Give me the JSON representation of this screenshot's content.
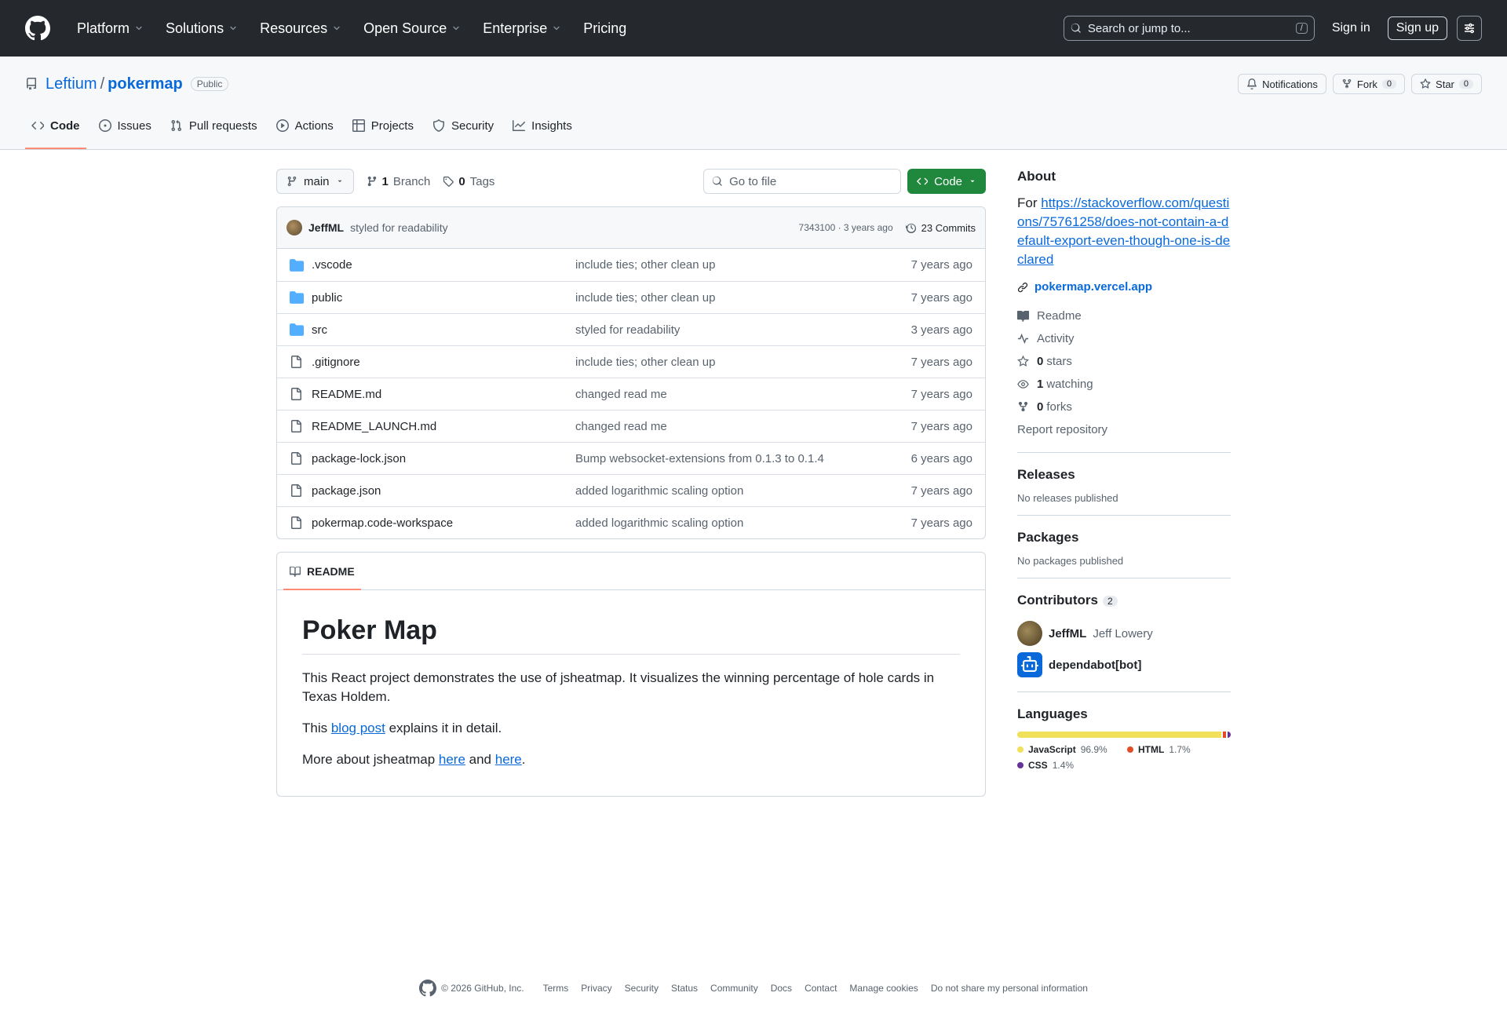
{
  "header": {
    "nav": [
      {
        "label": "Platform",
        "dropdown": true
      },
      {
        "label": "Solutions",
        "dropdown": true
      },
      {
        "label": "Resources",
        "dropdown": true
      },
      {
        "label": "Open Source",
        "dropdown": true
      },
      {
        "label": "Enterprise",
        "dropdown": true
      },
      {
        "label": "Pricing",
        "dropdown": false
      }
    ],
    "search_placeholder": "Search or jump to...",
    "search_shortcut": "/",
    "sign_in": "Sign in",
    "sign_up": "Sign up"
  },
  "repo": {
    "owner": "Leftium",
    "separator": "/",
    "name": "pokermap",
    "visibility": "Public",
    "notifications_label": "Notifications",
    "fork_label": "Fork",
    "fork_count": "0",
    "star_label": "Star",
    "star_count": "0"
  },
  "tabs": [
    {
      "label": "Code",
      "icon": "code-icon",
      "active": true
    },
    {
      "label": "Issues",
      "icon": "issue-icon",
      "active": false
    },
    {
      "label": "Pull requests",
      "icon": "pull-request-icon",
      "active": false
    },
    {
      "label": "Actions",
      "icon": "play-icon",
      "active": false
    },
    {
      "label": "Projects",
      "icon": "table-icon",
      "active": false
    },
    {
      "label": "Security",
      "icon": "shield-icon",
      "active": false
    },
    {
      "label": "Insights",
      "icon": "graph-icon",
      "active": false
    }
  ],
  "filebar": {
    "branch": "main",
    "branch_count": "1",
    "branch_label": "Branch",
    "tag_count": "0",
    "tag_label": "Tags",
    "goto_placeholder": "Go to file",
    "code_button": "Code"
  },
  "commit": {
    "author": "JeffML",
    "message": "styled for readability",
    "meta": "7343100 · 3 years ago",
    "commits": "23 Commits"
  },
  "files": [
    {
      "name": ".vscode",
      "type": "dir",
      "message": "include ties; other clean up",
      "age": "7 years ago"
    },
    {
      "name": "public",
      "type": "dir",
      "message": "include ties; other clean up",
      "age": "7 years ago"
    },
    {
      "name": "src",
      "type": "dir",
      "message": "styled for readability",
      "age": "3 years ago"
    },
    {
      "name": ".gitignore",
      "type": "file",
      "message": "include ties; other clean up",
      "age": "7 years ago"
    },
    {
      "name": "README.md",
      "type": "file",
      "message": "changed read me",
      "age": "7 years ago"
    },
    {
      "name": "README_LAUNCH.md",
      "type": "file",
      "message": "changed read me",
      "age": "7 years ago"
    },
    {
      "name": "package-lock.json",
      "type": "file",
      "message": "Bump websocket-extensions from 0.1.3 to 0.1.4",
      "age": "6 years ago"
    },
    {
      "name": "package.json",
      "type": "file",
      "message": "added logarithmic scaling option",
      "age": "7 years ago"
    },
    {
      "name": "pokermap.code-workspace",
      "type": "file",
      "message": "added logarithmic scaling option",
      "age": "7 years ago"
    }
  ],
  "readme": {
    "tab_label": "README",
    "title": "Poker Map",
    "p1": "This React project demonstrates the use of jsheatmap. It visualizes the winning percentage of hole cards in Texas Holdem.",
    "p2_pre": "This ",
    "p2_link": "blog post",
    "p2_post": " explains it in detail.",
    "p3_pre": "More about jsheatmap ",
    "p3_link1": "here",
    "p3_mid": " and ",
    "p3_link2": "here",
    "p3_post": "."
  },
  "about": {
    "heading": "About",
    "text_pre": "For ",
    "link": "https://stackoverflow.com/questions/75761258/does-not-contain-a-default-export-even-though-one-is-declared",
    "homepage": "pokermap.vercel.app",
    "readme": "Readme",
    "activity": "Activity",
    "stars_count": "0",
    "stars_label": "stars",
    "watching_count": "1",
    "watching_label": "watching",
    "forks_count": "0",
    "forks_label": "forks",
    "report": "Report repository"
  },
  "releases": {
    "heading": "Releases",
    "text": "No releases published"
  },
  "packages": {
    "heading": "Packages",
    "text": "No packages published"
  },
  "contributors": {
    "heading": "Contributors",
    "count": "2",
    "list": [
      {
        "login": "JeffML",
        "name": "Jeff Lowery"
      },
      {
        "login": "dependabot[bot]",
        "name": ""
      }
    ]
  },
  "languages": {
    "heading": "Languages",
    "list": [
      {
        "name": "JavaScript",
        "percent": "96.9%",
        "value": 96.9,
        "color": "#f1e05a"
      },
      {
        "name": "HTML",
        "percent": "1.7%",
        "value": 1.7,
        "color": "#e34c26"
      },
      {
        "name": "CSS",
        "percent": "1.4%",
        "value": 1.4,
        "color": "#663399"
      }
    ]
  },
  "footer": {
    "copyright": "© 2026 GitHub, Inc.",
    "links": [
      "Terms",
      "Privacy",
      "Security",
      "Status",
      "Community",
      "Docs",
      "Contact",
      "Manage cookies",
      "Do not share my personal information"
    ]
  }
}
